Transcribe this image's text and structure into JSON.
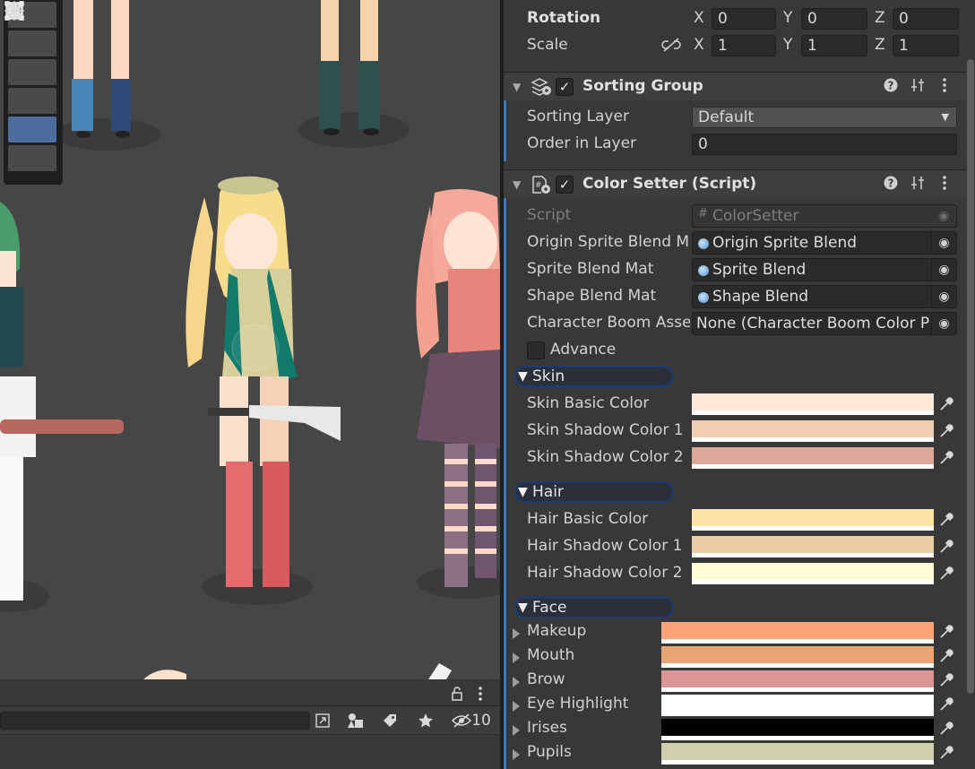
{
  "transform": {
    "rotation": {
      "label": "Rotation",
      "x": "0",
      "y": "0",
      "z": "0"
    },
    "scale": {
      "label": "Scale",
      "x": "1",
      "y": "1",
      "z": "1"
    },
    "axes": {
      "x": "X",
      "y": "Y",
      "z": "Z"
    }
  },
  "sorting_group": {
    "title": "Sorting Group",
    "sorting_layer_label": "Sorting Layer",
    "sorting_layer_value": "Default",
    "order_label": "Order in Layer",
    "order_value": "0"
  },
  "color_setter": {
    "title": "Color Setter (Script)",
    "script_label": "Script",
    "script_value": "ColorSetter",
    "fields": [
      {
        "label": "Origin Sprite Blend M",
        "value": "Origin Sprite Blend"
      },
      {
        "label": "Sprite Blend Mat",
        "value": "Sprite Blend"
      },
      {
        "label": "Shape Blend Mat",
        "value": "Shape Blend"
      },
      {
        "label": "Character Boom Asse",
        "value": "None (Character Boom Color P"
      }
    ],
    "advance_label": "Advance",
    "groups": {
      "skin": {
        "title": "Skin",
        "colors": [
          {
            "label": "Skin Basic Color",
            "color": "#fde7d6"
          },
          {
            "label": "Skin Shadow Color 1",
            "color": "#f1cdb4"
          },
          {
            "label": "Skin Shadow Color 2",
            "color": "#dba899"
          }
        ]
      },
      "hair": {
        "title": "Hair",
        "colors": [
          {
            "label": "Hair Basic Color",
            "color": "#fde3a6"
          },
          {
            "label": "Hair Shadow Color 1",
            "color": "#eacda2"
          },
          {
            "label": "Hair Shadow Color 2",
            "color": "#fefcd2"
          }
        ]
      },
      "face": {
        "title": "Face",
        "items": [
          {
            "label": "Makeup",
            "color": "#fca478"
          },
          {
            "label": "Mouth",
            "color": "#e9a473"
          },
          {
            "label": "Brow",
            "color": "#dc9595"
          },
          {
            "label": "Eye Highlight",
            "color": "#ffffff"
          },
          {
            "label": "Irises",
            "color": "#000000"
          },
          {
            "label": "Pupils",
            "color": "#cfd1ad"
          }
        ]
      }
    }
  },
  "project_bar": {
    "hidden_count": "10"
  },
  "icons": {
    "tools": [
      "hand-tool-icon",
      "move-tool-icon",
      "rotate-tool-icon",
      "scale-tool-icon",
      "rect-tool-icon",
      "transform-tool-icon"
    ],
    "picker": "eyedropper-icon",
    "object_picker": "object-picker-icon"
  }
}
